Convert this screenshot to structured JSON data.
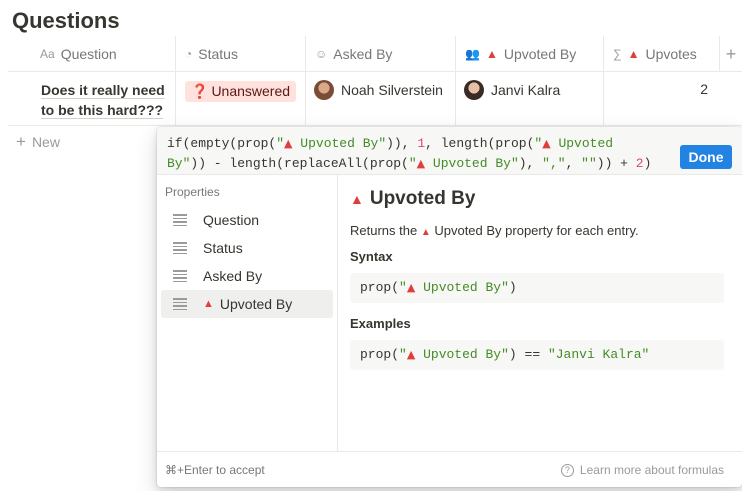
{
  "page": {
    "title": "Questions"
  },
  "table": {
    "columns": [
      {
        "icon": "text-icon",
        "icon_glyph": "Aa",
        "label": "Question"
      },
      {
        "icon": "status-icon",
        "icon_glyph": "◔",
        "label": "Status"
      },
      {
        "icon": "person-icon",
        "icon_glyph": "☺",
        "label": "Asked By"
      },
      {
        "icon": "people-icon",
        "icon_glyph": "👥",
        "prefix": "▲",
        "label": "Upvoted By"
      },
      {
        "icon": "sigma-icon",
        "icon_glyph": "∑",
        "prefix": "▲",
        "label": "Upvotes"
      }
    ],
    "more_glyph": "+",
    "row": {
      "question": "Does it really need to be this hard???",
      "status_mark": "❓",
      "status": "Unanswered",
      "asked_by": "Noah Silverstein",
      "upvoted_by": "Janvi Kalra",
      "upvotes": "2"
    },
    "new_label": "New"
  },
  "formula": {
    "code_parts": {
      "p1": "if(empty(prop(",
      "s1": "\"",
      "t1": "▲",
      "s2": " Upvoted By\"",
      "p2": ")), ",
      "n1": "1",
      "p3": ", length(prop(",
      "s3": "\"",
      "t2": "▲",
      "s4": " Upvoted\nBy\"",
      "p4": ")) - length(replaceAll(prop(",
      "s5": "\"",
      "t3": "▲",
      "s6": " Upvoted By\"",
      "p5": "), ",
      "s7": "\",\"",
      "p6": ", ",
      "s8": "\"\"",
      "p7": ")) + ",
      "n2": "2",
      "p8": ")"
    },
    "done_label": "Done",
    "properties_label": "Properties",
    "properties": [
      "Question",
      "Status",
      "Asked By",
      "Upvoted By"
    ],
    "selected_property_prefix": "▲",
    "doc": {
      "title_prefix": "▲",
      "title": "Upvoted By",
      "desc_before": "Returns the ",
      "desc_prefix": "▲",
      "desc_after": " Upvoted By property for each entry.",
      "syntax_label": "Syntax",
      "syntax_fn": "prop(",
      "syntax_q": "\"",
      "syntax_tri": "▲",
      "syntax_str": " Upvoted By\"",
      "syntax_close": ")",
      "examples_label": "Examples",
      "example_fn": "prop(",
      "example_q": "\"",
      "example_tri": "▲",
      "example_str": " Upvoted By\"",
      "example_op": ") == ",
      "example_value": "\"Janvi Kalra\""
    },
    "hint": "⌘+Enter to accept",
    "learn_glyph": "?",
    "learn_label": "Learn more about formulas"
  }
}
